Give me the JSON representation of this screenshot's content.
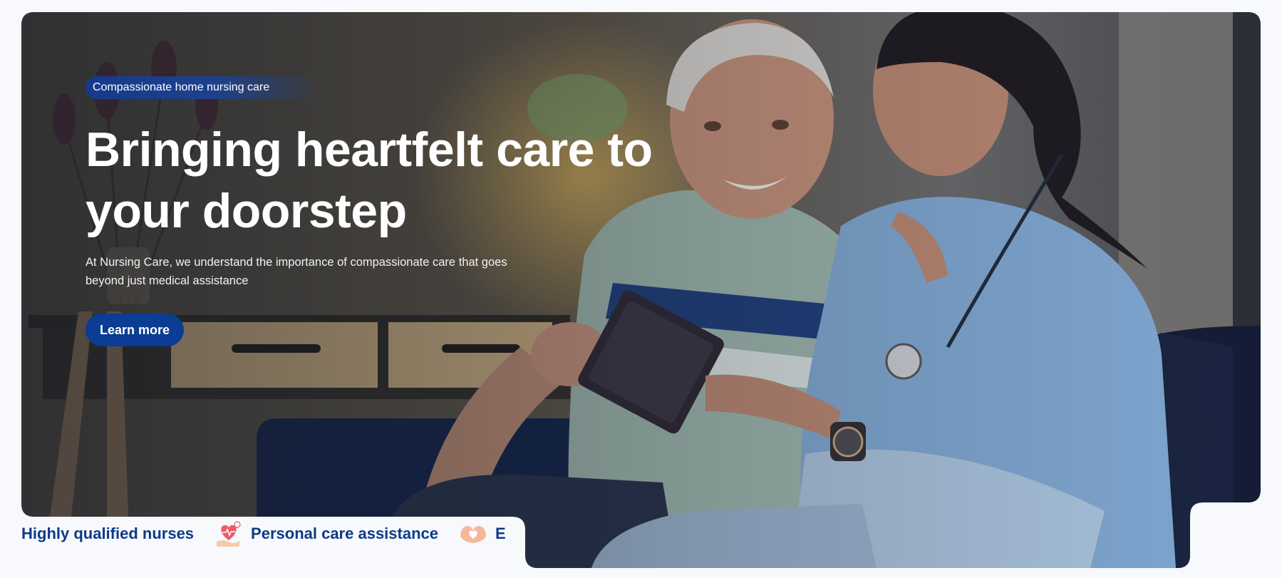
{
  "hero": {
    "badge": "Compassionate home nursing care",
    "headline_line1": "Bringing heartfelt care to",
    "headline_line2": "your doorstep",
    "description": "At Nursing Care, we understand the importance of compassionate care that goes beyond just medical assistance",
    "cta_label": "Learn more"
  },
  "features": [
    {
      "label": "Highly qualified nurses",
      "icon": "qualified-nurse-icon"
    },
    {
      "label": "Personal care assistance",
      "icon": "heart-hand-icon"
    },
    {
      "label": "E",
      "icon": "heart-hands-icon"
    }
  ],
  "colors": {
    "accent": "#0a3d93",
    "feature_text": "#0f3a87",
    "page_bg": "#f7f9fd",
    "scrub_blue": "#7fa7d1"
  }
}
